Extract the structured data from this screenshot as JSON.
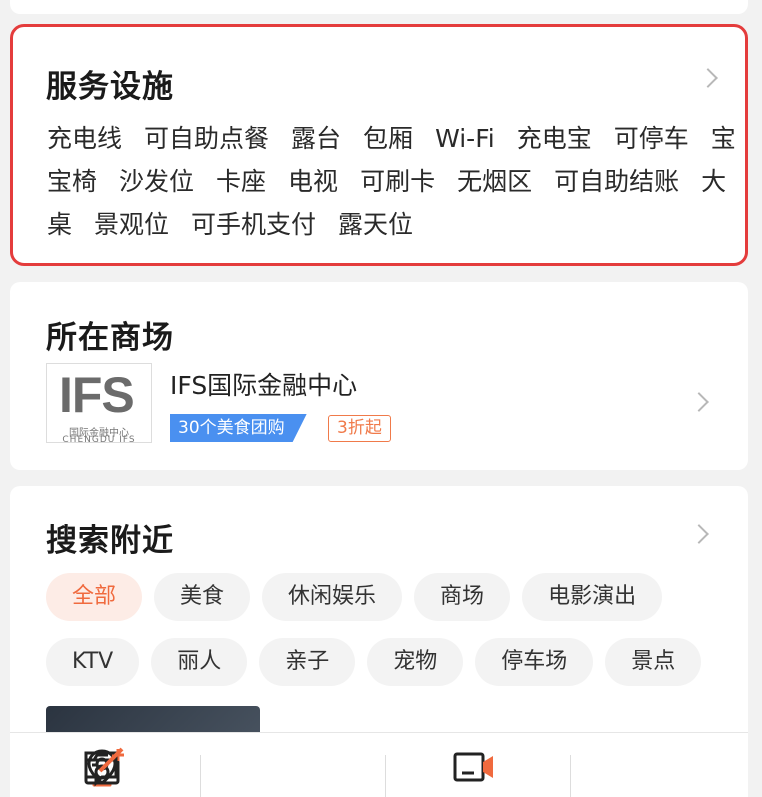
{
  "services": {
    "title": "服务设施",
    "items": [
      "充电线",
      "可自助点餐",
      "露台",
      "包厢",
      "Wi-Fi",
      "充电宝",
      "可停车",
      "宝宝椅",
      "沙发位",
      "卡座",
      "电视",
      "可刷卡",
      "无烟区",
      "可自助结账",
      "大桌",
      "景观位",
      "可手机支付",
      "露天位"
    ]
  },
  "mall": {
    "title": "所在商场",
    "logo_text": "IFS",
    "logo_sub1": "国际金融中心",
    "logo_sub2": "CHENGDU IFS",
    "name": "IFS国际金融中心",
    "tag_deals": "30个美食团购",
    "tag_discount": "3折起"
  },
  "nearby": {
    "title": "搜索附近",
    "chips": [
      "全部",
      "美食",
      "休闲娱乐",
      "商场",
      "电影演出",
      "KTV",
      "丽人",
      "亲子",
      "宠物",
      "停车场",
      "景点"
    ],
    "active_chip": "全部"
  },
  "tabbar": {
    "icons": [
      "location-pin-icon",
      "video-icon",
      "camera-add-icon",
      "edit-review-icon"
    ]
  },
  "colors": {
    "highlight_border": "#e43c3c",
    "accent_orange": "#f06a3e",
    "tag_blue": "#4a90f0"
  }
}
